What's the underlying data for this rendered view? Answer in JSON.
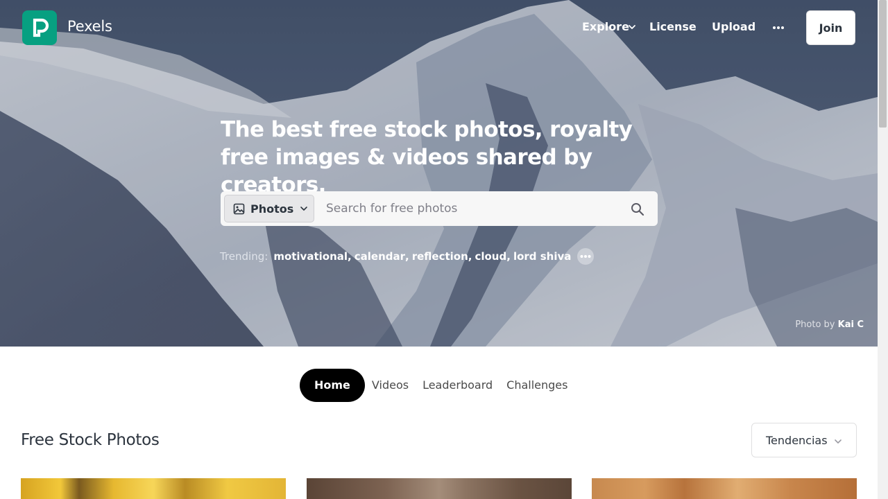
{
  "nav": {
    "logo_alt": "Pexels logo",
    "brand": "Pexels",
    "explore": "Explore",
    "license": "License",
    "upload": "Upload",
    "join": "Join"
  },
  "hero": {
    "headline": "The best free stock photos, royalty free images & videos shared by creators.",
    "search": {
      "type_label": "Photos",
      "placeholder": "Search for free photos"
    },
    "trending": {
      "label": "Trending:",
      "items": [
        "motivational",
        "calendar",
        "reflection",
        "cloud",
        "lord shiva"
      ]
    },
    "credit": {
      "prefix": "Photo by",
      "author": "Kai C"
    }
  },
  "tabs": [
    "Home",
    "Videos",
    "Leaderboard",
    "Challenges"
  ],
  "section": {
    "title": "Free Stock Photos",
    "sort_label": "Tendencias"
  },
  "colors": {
    "brand": "#07a081",
    "active_tab": "#000000"
  }
}
